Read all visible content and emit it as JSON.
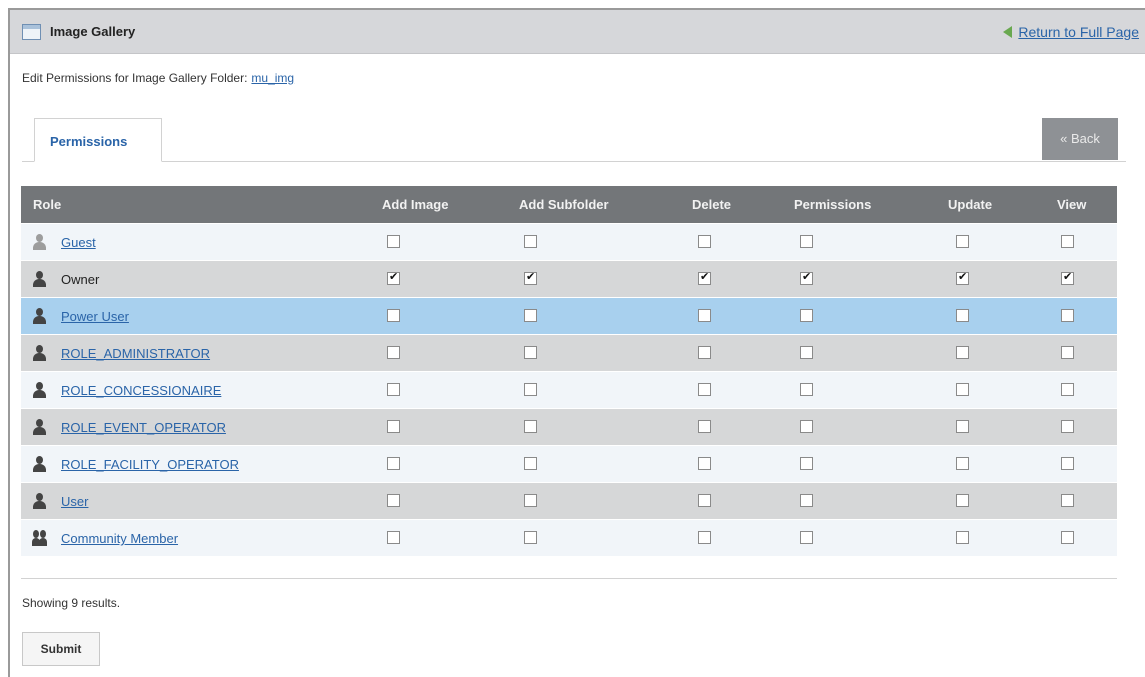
{
  "portlet": {
    "title": "Image Gallery",
    "return_link": "Return to Full Page"
  },
  "edit": {
    "label": "Edit Permissions for Image Gallery Folder:",
    "folder_name": "mu_img"
  },
  "tabs": [
    {
      "label": "Permissions"
    }
  ],
  "back_button": "« Back",
  "table": {
    "headers": [
      "Role",
      "Add Image",
      "Add Subfolder",
      "Delete",
      "Permissions",
      "Update",
      "View"
    ],
    "rows": [
      {
        "role": "Guest",
        "icon": "guest-user-icon",
        "link": true,
        "checked": [
          false,
          false,
          false,
          false,
          false,
          false
        ]
      },
      {
        "role": "Owner",
        "icon": "user-icon",
        "link": false,
        "checked": [
          true,
          true,
          true,
          true,
          true,
          true
        ]
      },
      {
        "role": "Power User",
        "icon": "user-icon",
        "link": true,
        "checked": [
          false,
          false,
          false,
          false,
          false,
          false
        ]
      },
      {
        "role": "ROLE_ADMINISTRATOR",
        "icon": "user-icon",
        "link": true,
        "checked": [
          false,
          false,
          false,
          false,
          false,
          false
        ]
      },
      {
        "role": "ROLE_CONCESSIONAIRE",
        "icon": "user-icon",
        "link": true,
        "checked": [
          false,
          false,
          false,
          false,
          false,
          false
        ]
      },
      {
        "role": "ROLE_EVENT_OPERATOR",
        "icon": "user-icon",
        "link": true,
        "checked": [
          false,
          false,
          false,
          false,
          false,
          false
        ]
      },
      {
        "role": "ROLE_FACILITY_OPERATOR",
        "icon": "user-icon",
        "link": true,
        "checked": [
          false,
          false,
          false,
          false,
          false,
          false
        ]
      },
      {
        "role": "User",
        "icon": "user-icon",
        "link": true,
        "checked": [
          false,
          false,
          false,
          false,
          false,
          false
        ]
      },
      {
        "role": "Community Member",
        "icon": "group-icon",
        "link": true,
        "checked": [
          false,
          false,
          false,
          false,
          false,
          false
        ]
      }
    ]
  },
  "results_text": "Showing 9 results.",
  "submit_button": "Submit",
  "colors": {
    "header_bar": "#d6d7da",
    "table_header": "#737679",
    "row_highlight": "#a8d0ee",
    "link": "#2a64a8"
  }
}
